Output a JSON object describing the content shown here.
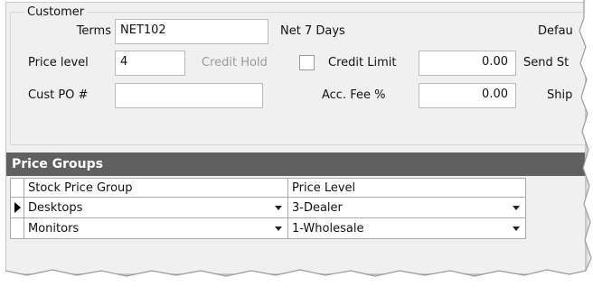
{
  "customer": {
    "group_title": "Customer",
    "terms_label": "Terms",
    "terms_value": "NET102",
    "terms_desc": "Net 7 Days",
    "default_label": "Defau",
    "price_level_label": "Price level",
    "price_level_value": "4",
    "credit_hold_label": "Credit Hold",
    "credit_limit_label": "Credit Limit",
    "credit_limit_value": "0.00",
    "send_label": "Send St",
    "cust_po_label": "Cust PO #",
    "cust_po_value": "",
    "acc_fee_label": "Acc. Fee %",
    "acc_fee_value": "0.00",
    "ship_label": "Ship"
  },
  "price_groups": {
    "title": "Price Groups",
    "columns": [
      "Stock Price Group",
      "Price Level"
    ],
    "rows": [
      {
        "stock_price_group": "Desktops",
        "price_level": "3-Dealer",
        "current": true
      },
      {
        "stock_price_group": "Monitors",
        "price_level": "1-Wholesale",
        "current": false
      }
    ]
  },
  "icons": {
    "row_indicator": "current-row-pointer-icon",
    "dropdown": "chevron-down-icon"
  },
  "colors": {
    "panel_bg": "#f0f0f0",
    "section_header_bg": "#606060",
    "section_header_text": "#ffffff",
    "disabled_text": "#9a9a9a"
  }
}
